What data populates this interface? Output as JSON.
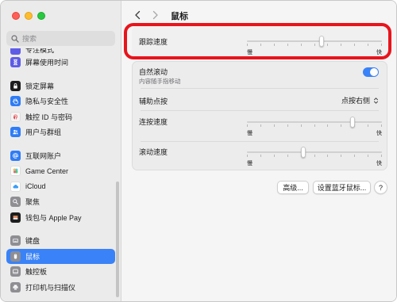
{
  "window": {
    "title": "鼠标"
  },
  "traffic_lights": {
    "close": "#ff5f57",
    "minimize": "#febc2e",
    "maximize": "#28c840"
  },
  "sidebar": {
    "search_placeholder": "搜索",
    "partial_top_item": {
      "label": "专注模式",
      "icon": "moon-icon",
      "color": "#5e5ce6"
    },
    "items": [
      {
        "label": "屏幕使用时间",
        "icon": "hourglass-icon",
        "color": "#5e5ce6",
        "gap_before": false
      },
      {
        "label": "锁定屏幕",
        "icon": "lock-icon",
        "color": "#1d1d1f",
        "gap_before": true
      },
      {
        "label": "隐私与安全性",
        "icon": "hand-icon",
        "color": "#2f7cf6",
        "gap_before": false
      },
      {
        "label": "触控 ID 与密码",
        "icon": "fingerprint-icon",
        "color": "#f4f4f4",
        "gap_before": false
      },
      {
        "label": "用户与群组",
        "icon": "users-icon",
        "color": "#2f7cf6",
        "gap_before": false
      },
      {
        "label": "互联网账户",
        "icon": "at-icon",
        "color": "#2f7cf6",
        "gap_before": true
      },
      {
        "label": "Game Center",
        "icon": "game-center-icon",
        "color": "#ffffff",
        "gap_before": false
      },
      {
        "label": "iCloud",
        "icon": "cloud-icon",
        "color": "#ffffff",
        "gap_before": false
      },
      {
        "label": "聚焦",
        "icon": "spotlight-icon",
        "color": "#8e8e93",
        "gap_before": false
      },
      {
        "label": "钱包与 Apple Pay",
        "icon": "wallet-icon",
        "color": "#1d1d1f",
        "gap_before": false
      },
      {
        "label": "键盘",
        "icon": "keyboard-icon",
        "color": "#8e8e93",
        "gap_before": true
      },
      {
        "label": "鼠标",
        "icon": "mouse-icon",
        "color": "#8e8e93",
        "gap_before": false,
        "selected": true
      },
      {
        "label": "触控板",
        "icon": "trackpad-icon",
        "color": "#8e8e93",
        "gap_before": false
      },
      {
        "label": "打印机与扫描仪",
        "icon": "printer-icon",
        "color": "#8e8e93",
        "gap_before": false
      }
    ]
  },
  "main": {
    "title": "鼠标",
    "tracking": {
      "label": "跟踪速度",
      "min_label": "慢",
      "max_label": "快",
      "value": 0.55
    },
    "natural_scroll": {
      "label": "自然滚动",
      "sublabel": "内容随手指移动",
      "on": true
    },
    "secondary_click": {
      "label": "辅助点按",
      "value": "点按右侧"
    },
    "double_click": {
      "label": "连按速度",
      "min_label": "慢",
      "max_label": "快",
      "value": 0.78
    },
    "scroll_speed": {
      "label": "滚动速度",
      "min_label": "慢",
      "max_label": "快",
      "value": 0.42
    },
    "buttons": {
      "advanced": "高级...",
      "bluetooth": "设置蓝牙鼠标...",
      "help": "?"
    }
  },
  "accent_color": "#3a82f7",
  "highlight_color": "#e8141c"
}
